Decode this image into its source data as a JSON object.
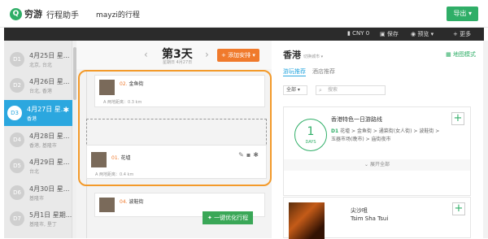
{
  "header": {
    "logo_mark": "Q",
    "logo_name": "穷游",
    "logo_sub": "行程助手",
    "trip_title": "mayzi的行程",
    "export_label": "导出 ▾"
  },
  "toolbar": {
    "currency": "CNY 0",
    "save": "保存",
    "preview": "预览 ▾",
    "more": "+ 更多"
  },
  "days": [
    {
      "code": "D1",
      "date": "4月25日 星...",
      "city": "北京, 台北"
    },
    {
      "code": "D2",
      "date": "4月26日 星...",
      "city": "台北, 香港"
    },
    {
      "code": "D3",
      "date": "4月27日 星...",
      "city": "香港"
    },
    {
      "code": "D4",
      "date": "4月28日 星...",
      "city": "香港, 基隆市"
    },
    {
      "code": "D5",
      "date": "4月29日 星...",
      "city": "台北"
    },
    {
      "code": "D6",
      "date": "4月30日 星...",
      "city": "基隆市"
    },
    {
      "code": "D7",
      "date": "5月1日 星期...",
      "city": "基隆市, 垦丁"
    }
  ],
  "center": {
    "day_title": "第3天",
    "day_sub": "星期日 4月27日",
    "add_label": "+ 添加安排 ▾",
    "cards": [
      {
        "num": "02.",
        "name": "金鱼街",
        "dist": "A 两地距离：0.3 km"
      },
      {
        "num": "01.",
        "name": "花墟",
        "dist": "A 两地距离：0.4 km"
      },
      {
        "num": "04.",
        "name": "波鞋街",
        "dist": ""
      }
    ],
    "optimize_label": "一键优化行程"
  },
  "right": {
    "city": "香港",
    "switch_city": "切换城市 ▾",
    "map_mode": "地图模式",
    "tab_play": "游玩推荐",
    "tab_hotel": "酒店推荐",
    "filter": "全部 ▾",
    "search_placeholder": "搜索",
    "route": {
      "days": "1",
      "days_label": "DAYS",
      "title": "香港特色一日游路线",
      "day_code": "D1",
      "path": [
        "花墟",
        "金鱼街",
        "通菜街(女人街)",
        "波鞋街",
        "玉器市场(晚市)",
        "庙街夜市"
      ]
    },
    "expand_label": "展开全部",
    "poi": {
      "name": "尖沙咀",
      "name_en": "Tsim Sha Tsui"
    }
  },
  "colors": {
    "brand_green": "#2fae67",
    "active_blue": "#2ba7df",
    "accent_orange": "#f07a2c"
  }
}
